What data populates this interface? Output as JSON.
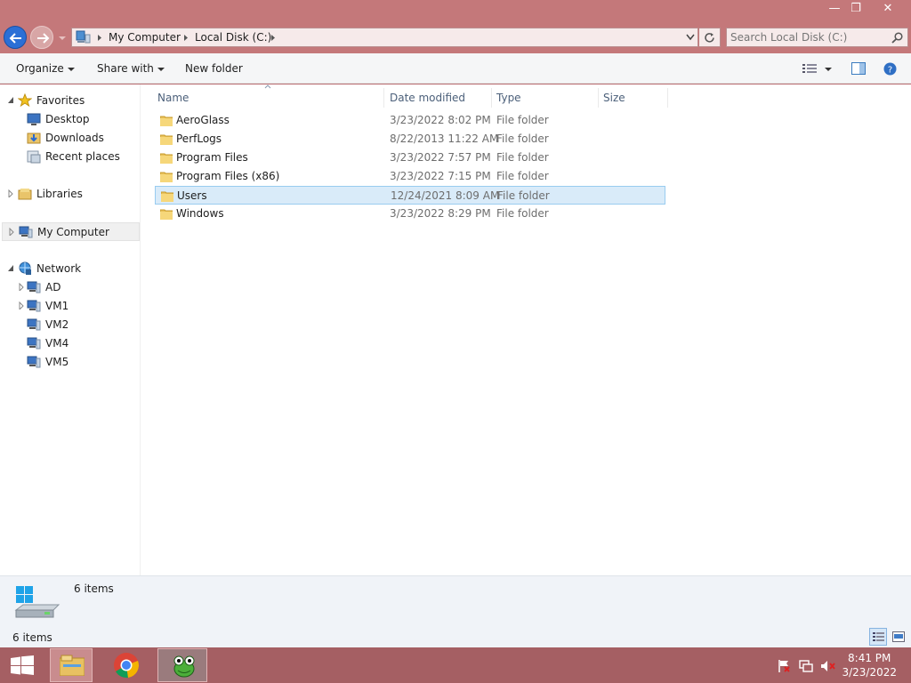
{
  "window": {
    "controls": {
      "minimize": "—",
      "restore": "❐",
      "close": "✕"
    }
  },
  "address": {
    "crumbs": [
      "My Computer",
      "Local Disk (C:)"
    ],
    "search_placeholder": "Search Local Disk (C:)"
  },
  "toolbar": {
    "organize": "Organize",
    "share_with": "Share with",
    "new_folder": "New folder"
  },
  "nav": {
    "favorites": {
      "label": "Favorites",
      "items": [
        "Desktop",
        "Downloads",
        "Recent places"
      ]
    },
    "libraries": "Libraries",
    "my_computer": "My Computer",
    "network": {
      "label": "Network",
      "items": [
        "AD",
        "VM1",
        "VM2",
        "VM4",
        "VM5"
      ]
    }
  },
  "columns": {
    "name": "Name",
    "date": "Date modified",
    "type": "Type",
    "size": "Size"
  },
  "files": [
    {
      "name": "AeroGlass",
      "date": "3/23/2022 8:02 PM",
      "type": "File folder"
    },
    {
      "name": "PerfLogs",
      "date": "8/22/2013 11:22 AM",
      "type": "File folder"
    },
    {
      "name": "Program Files",
      "date": "3/23/2022 7:57 PM",
      "type": "File folder"
    },
    {
      "name": "Program Files (x86)",
      "date": "3/23/2022 7:15 PM",
      "type": "File folder"
    },
    {
      "name": "Users",
      "date": "12/24/2021 8:09 AM",
      "type": "File folder",
      "selected": true
    },
    {
      "name": "Windows",
      "date": "3/23/2022 8:29 PM",
      "type": "File folder"
    }
  ],
  "details": {
    "count": "6 items"
  },
  "status": {
    "count": "6 items"
  },
  "taskbar": {
    "time": "8:41 PM",
    "date": "3/23/2022"
  },
  "colors": {
    "titlebar": "#c4787a",
    "selection_bg": "#d9ebf9",
    "selection_border": "#99ccf0",
    "taskbar": "#a55f63",
    "back_button": "#2b6fd6"
  }
}
